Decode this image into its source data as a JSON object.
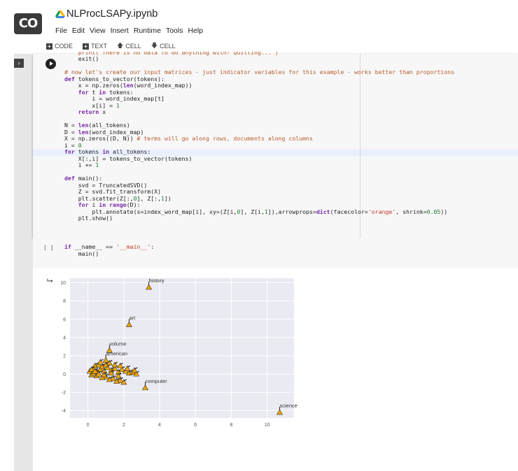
{
  "app": {
    "logo_text": "CO",
    "notebook_title": "NLProcLSAPy.ipynb",
    "star_glyph": "☆",
    "brand_colors": {
      "drive_green": "#0f9d58",
      "drive_yellow": "#fbbc04",
      "drive_blue": "#4285f4"
    }
  },
  "menu": [
    "File",
    "Edit",
    "View",
    "Insert",
    "Runtime",
    "Tools",
    "Help"
  ],
  "toolbar": {
    "code_label": "CODE",
    "text_label": "TEXT",
    "cell_up_label": "CELL",
    "cell_down_label": "CELL",
    "code_icon": "plus-square-icon",
    "up_icon": "arrow-up-icon",
    "down_icon": "arrow-down-icon"
  },
  "cell1": {
    "lines": [
      [
        {
          "t": "    print( There is no data to do anything with! Quitting... )",
          "c": "cut"
        }
      ],
      [
        {
          "t": "    exit()",
          "c": ""
        }
      ],
      [
        {
          "t": "",
          "c": ""
        }
      ],
      [
        {
          "t": "# now let's create our input matrices - just indicator variables for this example - works better than proportions",
          "c": "cm"
        }
      ],
      [
        {
          "t": "def ",
          "c": "kw"
        },
        {
          "t": "tokens_to_vector(tokens):",
          "c": ""
        }
      ],
      [
        {
          "t": "    x = np.zeros(",
          "c": ""
        },
        {
          "t": "len",
          "c": "kw"
        },
        {
          "t": "(word_index_map))",
          "c": ""
        }
      ],
      [
        {
          "t": "    for ",
          "c": "kw"
        },
        {
          "t": "t ",
          "c": ""
        },
        {
          "t": "in ",
          "c": "kw"
        },
        {
          "t": "tokens:",
          "c": ""
        }
      ],
      [
        {
          "t": "        i = word_index_map[t]",
          "c": ""
        }
      ],
      [
        {
          "t": "        x[i] = ",
          "c": ""
        },
        {
          "t": "1",
          "c": "num"
        }
      ],
      [
        {
          "t": "    return ",
          "c": "kw"
        },
        {
          "t": "x",
          "c": ""
        }
      ],
      [
        {
          "t": "",
          "c": ""
        }
      ],
      [
        {
          "t": "N = ",
          "c": ""
        },
        {
          "t": "len",
          "c": "kw"
        },
        {
          "t": "(all_tokens)",
          "c": ""
        }
      ],
      [
        {
          "t": "D = ",
          "c": ""
        },
        {
          "t": "len",
          "c": "kw"
        },
        {
          "t": "(word_index_map)",
          "c": ""
        }
      ],
      [
        {
          "t": "X = np.zeros((D, N)) ",
          "c": ""
        },
        {
          "t": "# terms will go along rows, documents along columns",
          "c": "cm"
        }
      ],
      [
        {
          "t": "i = ",
          "c": ""
        },
        {
          "t": "0",
          "c": "num"
        }
      ],
      [
        {
          "t": "for ",
          "c": "kw"
        },
        {
          "t": "tokens ",
          "c": ""
        },
        {
          "t": "in ",
          "c": "kw"
        },
        {
          "t": "all_tokens:",
          "c": ""
        }
      ],
      [
        {
          "t": "    X[:,i] = tokens_to_vector(tokens)",
          "c": ""
        }
      ],
      [
        {
          "t": "    i += ",
          "c": ""
        },
        {
          "t": "1",
          "c": "num"
        }
      ],
      [
        {
          "t": "",
          "c": ""
        }
      ],
      [
        {
          "t": "def ",
          "c": "kw"
        },
        {
          "t": "main():",
          "c": ""
        }
      ],
      [
        {
          "t": "    svd = TruncatedSVD()",
          "c": ""
        }
      ],
      [
        {
          "t": "    Z = svd.fit_transform(X)",
          "c": ""
        }
      ],
      [
        {
          "t": "    plt.scatter(Z[:,",
          "c": ""
        },
        {
          "t": "0",
          "c": "num"
        },
        {
          "t": "], Z[:,",
          "c": ""
        },
        {
          "t": "1",
          "c": "num"
        },
        {
          "t": "])",
          "c": ""
        }
      ],
      [
        {
          "t": "    for ",
          "c": "kw"
        },
        {
          "t": "i ",
          "c": ""
        },
        {
          "t": "in ",
          "c": "kw"
        },
        {
          "t": "range",
          "c": "kw"
        },
        {
          "t": "(D):",
          "c": ""
        }
      ],
      [
        {
          "t": "        plt.annotate(s=index_word_map[i], xy=(Z[i,",
          "c": ""
        },
        {
          "t": "0",
          "c": "num"
        },
        {
          "t": "], Z[i,",
          "c": ""
        },
        {
          "t": "1",
          "c": "num"
        },
        {
          "t": "]),arrowprops=",
          "c": ""
        },
        {
          "t": "dict",
          "c": "kw"
        },
        {
          "t": "(facecolor=",
          "c": ""
        },
        {
          "t": "'orange'",
          "c": "str"
        },
        {
          "t": ", shrink=",
          "c": ""
        },
        {
          "t": "0.05",
          "c": "num"
        },
        {
          "t": "))",
          "c": ""
        }
      ],
      [
        {
          "t": "    plt.show()",
          "c": ""
        }
      ]
    ]
  },
  "cell2": {
    "bracket": "[ ]",
    "lines": [
      [
        {
          "t": "if ",
          "c": "kw"
        },
        {
          "t": "__name__ == ",
          "c": ""
        },
        {
          "t": "'__main__'",
          "c": "str"
        },
        {
          "t": ":",
          "c": ""
        }
      ],
      [
        {
          "t": "    main()",
          "c": ""
        }
      ]
    ]
  },
  "output": {
    "icon": "output-arrow-icon"
  },
  "chart_data": {
    "type": "scatter",
    "xlim": [
      -1,
      11.5
    ],
    "ylim": [
      -4.8,
      10.5
    ],
    "xticks": [
      "0",
      "2",
      "4",
      "6",
      "8",
      "10"
    ],
    "xtick_values": [
      0,
      2,
      4,
      6,
      8,
      10
    ],
    "yticks": [
      "10",
      "8",
      "6",
      "4",
      "2",
      "0",
      "-2",
      "-4"
    ],
    "ytick_values": [
      10,
      8,
      6,
      4,
      2,
      0,
      -2,
      -4
    ],
    "grid": true,
    "marker_color": "#f0a500",
    "labeled_points": [
      {
        "label": "history",
        "x": 3.4,
        "y": 9.5
      },
      {
        "label": "art",
        "x": 2.3,
        "y": 5.4
      },
      {
        "label": "volume",
        "x": 1.2,
        "y": 2.6
      },
      {
        "label": "american",
        "x": 1.0,
        "y": 1.5
      },
      {
        "label": "computer",
        "x": 3.2,
        "y": -1.5
      },
      {
        "label": "science",
        "x": 10.7,
        "y": -4.2
      }
    ],
    "cluster": [
      [
        0.1,
        0.3
      ],
      [
        0.3,
        0.6
      ],
      [
        0.5,
        0.2
      ],
      [
        0.2,
        -0.1
      ],
      [
        0.7,
        0.5
      ],
      [
        0.9,
        0.3
      ],
      [
        1.1,
        0.7
      ],
      [
        0.4,
        0.9
      ],
      [
        0.6,
        1.0
      ],
      [
        0.8,
        0.8
      ],
      [
        1.3,
        0.4
      ],
      [
        1.5,
        0.6
      ],
      [
        1.7,
        0.2
      ],
      [
        1.9,
        0.5
      ],
      [
        2.1,
        0.3
      ],
      [
        2.3,
        0.1
      ],
      [
        2.5,
        0.2
      ],
      [
        2.7,
        0.0
      ],
      [
        0.3,
        0.1
      ],
      [
        0.5,
        -0.2
      ],
      [
        1.0,
        -0.3
      ],
      [
        1.4,
        -0.5
      ],
      [
        1.8,
        -0.7
      ],
      [
        2.0,
        -0.9
      ],
      [
        1.6,
        -0.8
      ],
      [
        1.2,
        -0.6
      ],
      [
        0.8,
        -0.4
      ],
      [
        0.2,
        0.5
      ],
      [
        0.4,
        0.3
      ],
      [
        1.0,
        1.0
      ],
      [
        1.2,
        1.2
      ],
      [
        0.7,
        1.3
      ],
      [
        1.5,
        1.0
      ],
      [
        1.8,
        0.9
      ],
      [
        2.2,
        0.6
      ],
      [
        2.6,
        0.4
      ],
      [
        0.6,
        0.0
      ],
      [
        0.9,
        -0.1
      ],
      [
        1.3,
        0.1
      ],
      [
        1.7,
        -0.2
      ]
    ]
  }
}
